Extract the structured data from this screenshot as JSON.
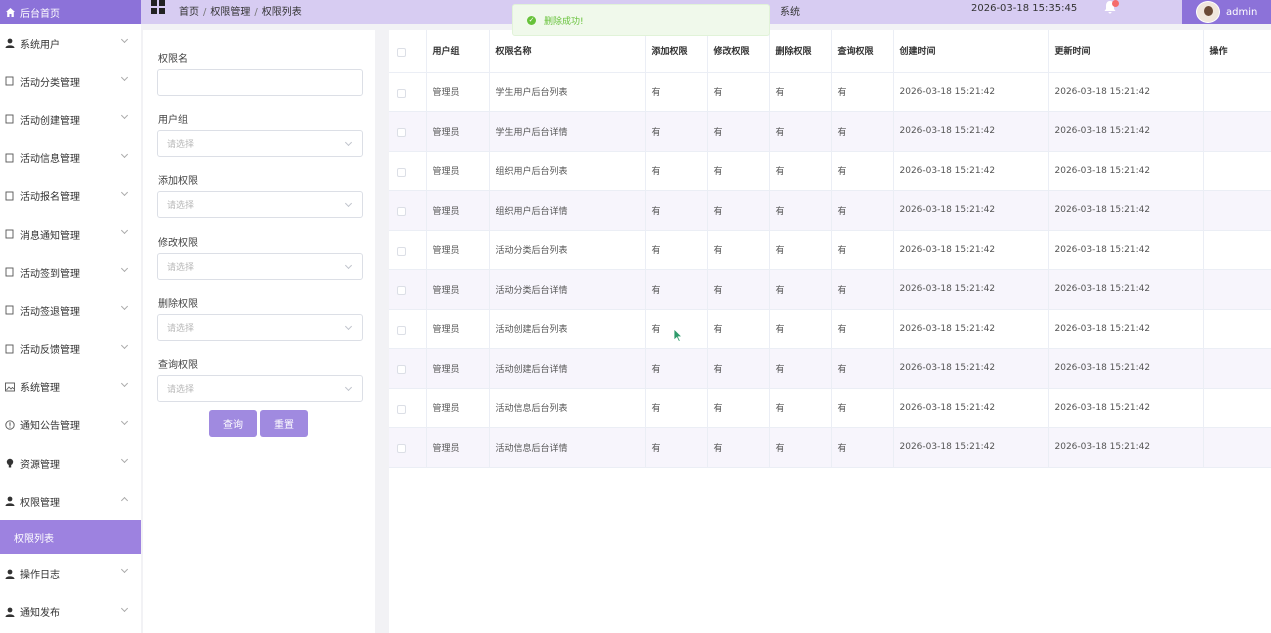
{
  "header": {
    "home_label": "后台首页",
    "breadcrumb": [
      "首页",
      "权限管理",
      "权限列表"
    ],
    "system_title": "系统",
    "datetime": "2026-03-18 15:35:45",
    "username": "admin"
  },
  "toast": {
    "message": "删除成功!"
  },
  "sidebar": {
    "items": [
      {
        "label": "系统用户",
        "icon": "user-icon"
      },
      {
        "label": "活动分类管理",
        "icon": "doc-icon"
      },
      {
        "label": "活动创建管理",
        "icon": "doc-icon"
      },
      {
        "label": "活动信息管理",
        "icon": "doc-icon"
      },
      {
        "label": "活动报名管理",
        "icon": "doc-icon"
      },
      {
        "label": "消息通知管理",
        "icon": "doc-icon"
      },
      {
        "label": "活动签到管理",
        "icon": "doc-icon"
      },
      {
        "label": "活动签退管理",
        "icon": "doc-icon"
      },
      {
        "label": "活动反馈管理",
        "icon": "doc-icon"
      },
      {
        "label": "系统管理",
        "icon": "picture-icon"
      },
      {
        "label": "通知公告管理",
        "icon": "info-icon"
      },
      {
        "label": "资源管理",
        "icon": "bulb-icon"
      },
      {
        "label": "权限管理",
        "icon": "user-icon",
        "expanded": true
      },
      {
        "label": "操作日志",
        "icon": "user-icon"
      },
      {
        "label": "通知发布",
        "icon": "user-icon"
      }
    ],
    "active_sub": "权限列表"
  },
  "filter": {
    "name_label": "权限名",
    "name_value": "",
    "group_label": "用户组",
    "add_label": "添加权限",
    "edit_label": "修改权限",
    "delete_label": "删除权限",
    "query_label": "查询权限",
    "select_placeholder": "请选择",
    "search_button": "查询",
    "reset_button": "重置"
  },
  "table": {
    "columns": [
      "用户组",
      "权限名称",
      "添加权限",
      "修改权限",
      "删除权限",
      "查询权限",
      "创建时间",
      "更新时间",
      "操作"
    ],
    "rows": [
      [
        "管理员",
        "学生用户后台列表",
        "有",
        "有",
        "有",
        "有",
        "2026-03-18 15:21:42",
        "2026-03-18 15:21:42"
      ],
      [
        "管理员",
        "学生用户后台详情",
        "有",
        "有",
        "有",
        "有",
        "2026-03-18 15:21:42",
        "2026-03-18 15:21:42"
      ],
      [
        "管理员",
        "组织用户后台列表",
        "有",
        "有",
        "有",
        "有",
        "2026-03-18 15:21:42",
        "2026-03-18 15:21:42"
      ],
      [
        "管理员",
        "组织用户后台详情",
        "有",
        "有",
        "有",
        "有",
        "2026-03-18 15:21:42",
        "2026-03-18 15:21:42"
      ],
      [
        "管理员",
        "活动分类后台列表",
        "有",
        "有",
        "有",
        "有",
        "2026-03-18 15:21:42",
        "2026-03-18 15:21:42"
      ],
      [
        "管理员",
        "活动分类后台详情",
        "有",
        "有",
        "有",
        "有",
        "2026-03-18 15:21:42",
        "2026-03-18 15:21:42"
      ],
      [
        "管理员",
        "活动创建后台列表",
        "有",
        "有",
        "有",
        "有",
        "2026-03-18 15:21:42",
        "2026-03-18 15:21:42"
      ],
      [
        "管理员",
        "活动创建后台详情",
        "有",
        "有",
        "有",
        "有",
        "2026-03-18 15:21:42",
        "2026-03-18 15:21:42"
      ],
      [
        "管理员",
        "活动信息后台列表",
        "有",
        "有",
        "有",
        "有",
        "2026-03-18 15:21:42",
        "2026-03-18 15:21:42"
      ],
      [
        "管理员",
        "活动信息后台详情",
        "有",
        "有",
        "有",
        "有",
        "2026-03-18 15:21:42",
        "2026-03-18 15:21:42"
      ]
    ]
  },
  "colors": {
    "accent": "#8c72d9",
    "header_bg": "#d7ccf2",
    "success": "#67c23a"
  }
}
